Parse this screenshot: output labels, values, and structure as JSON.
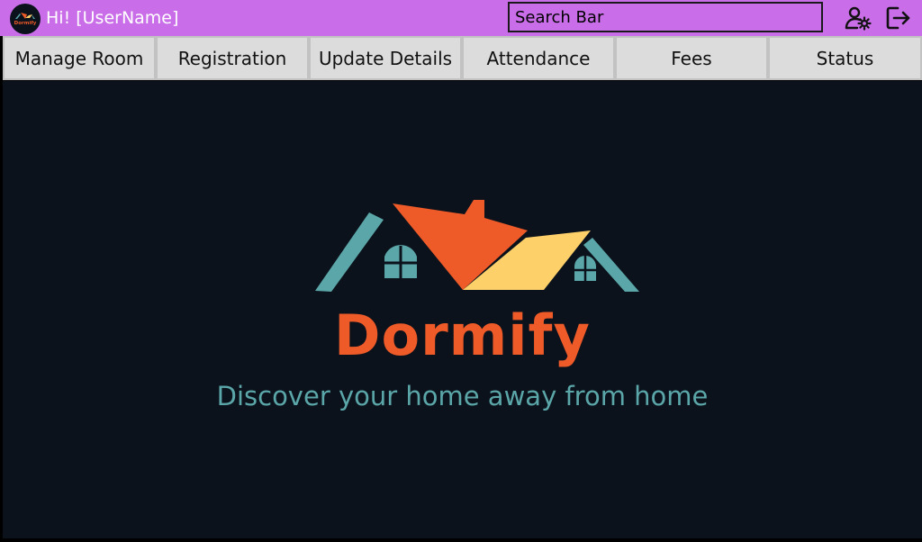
{
  "header": {
    "logo_text": "Dormify",
    "greeting": "Hi! [UserName]",
    "search": {
      "placeholder": "Search Bar",
      "value": ""
    },
    "icons": [
      "user-settings-icon",
      "logout-icon"
    ]
  },
  "nav": {
    "tabs": [
      {
        "label": "Manage Room"
      },
      {
        "label": "Registration"
      },
      {
        "label": "Update Details"
      },
      {
        "label": "Attendance"
      },
      {
        "label": "Fees"
      },
      {
        "label": "Status"
      }
    ]
  },
  "main": {
    "brand_name": "Dormify",
    "tagline": "Discover your home away from home"
  },
  "colors": {
    "header_bg": "#c96ee8",
    "tab_bg": "#dcdcdc",
    "main_bg": "#0b121c",
    "brand_orange": "#ee5a28",
    "brand_yellow": "#fdd06a",
    "brand_teal": "#5ba6a8"
  }
}
